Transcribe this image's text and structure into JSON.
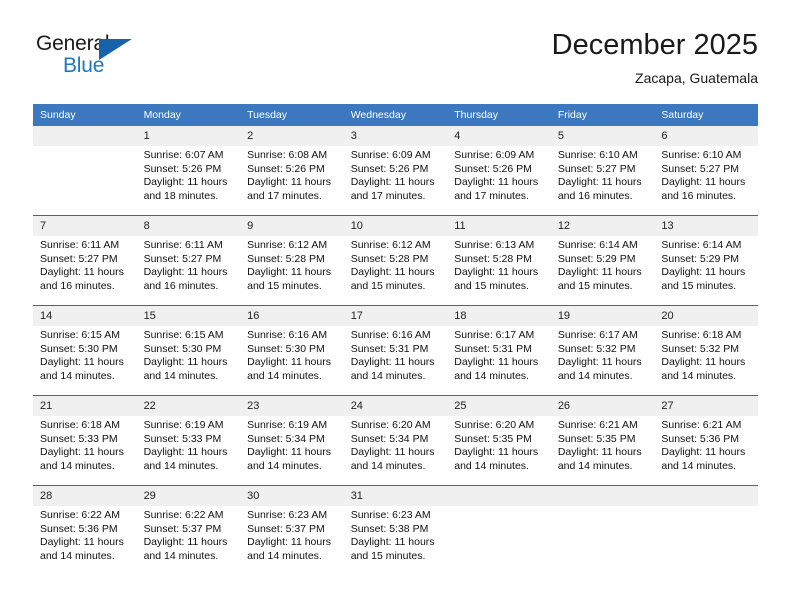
{
  "logo": {
    "word_top": "General",
    "word_bottom": "Blue",
    "accent_color": "#1763ab",
    "blue_text_color": "#1f78c1"
  },
  "header": {
    "title": "December 2025",
    "subtitle": "Zacapa, Guatemala"
  },
  "theme": {
    "header_bg": "#3b78bf",
    "header_text": "#ffffff",
    "daynum_bg": "#f0f0f0",
    "row_divider": "#2e6daa"
  },
  "weekdays": [
    "Sunday",
    "Monday",
    "Tuesday",
    "Wednesday",
    "Thursday",
    "Friday",
    "Saturday"
  ],
  "weeks": [
    [
      {
        "day": "",
        "sunrise": "",
        "sunset": "",
        "daylight": ""
      },
      {
        "day": "1",
        "sunrise": "Sunrise: 6:07 AM",
        "sunset": "Sunset: 5:26 PM",
        "daylight": "Daylight: 11 hours and 18 minutes."
      },
      {
        "day": "2",
        "sunrise": "Sunrise: 6:08 AM",
        "sunset": "Sunset: 5:26 PM",
        "daylight": "Daylight: 11 hours and 17 minutes."
      },
      {
        "day": "3",
        "sunrise": "Sunrise: 6:09 AM",
        "sunset": "Sunset: 5:26 PM",
        "daylight": "Daylight: 11 hours and 17 minutes."
      },
      {
        "day": "4",
        "sunrise": "Sunrise: 6:09 AM",
        "sunset": "Sunset: 5:26 PM",
        "daylight": "Daylight: 11 hours and 17 minutes."
      },
      {
        "day": "5",
        "sunrise": "Sunrise: 6:10 AM",
        "sunset": "Sunset: 5:27 PM",
        "daylight": "Daylight: 11 hours and 16 minutes."
      },
      {
        "day": "6",
        "sunrise": "Sunrise: 6:10 AM",
        "sunset": "Sunset: 5:27 PM",
        "daylight": "Daylight: 11 hours and 16 minutes."
      }
    ],
    [
      {
        "day": "7",
        "sunrise": "Sunrise: 6:11 AM",
        "sunset": "Sunset: 5:27 PM",
        "daylight": "Daylight: 11 hours and 16 minutes."
      },
      {
        "day": "8",
        "sunrise": "Sunrise: 6:11 AM",
        "sunset": "Sunset: 5:27 PM",
        "daylight": "Daylight: 11 hours and 16 minutes."
      },
      {
        "day": "9",
        "sunrise": "Sunrise: 6:12 AM",
        "sunset": "Sunset: 5:28 PM",
        "daylight": "Daylight: 11 hours and 15 minutes."
      },
      {
        "day": "10",
        "sunrise": "Sunrise: 6:12 AM",
        "sunset": "Sunset: 5:28 PM",
        "daylight": "Daylight: 11 hours and 15 minutes."
      },
      {
        "day": "11",
        "sunrise": "Sunrise: 6:13 AM",
        "sunset": "Sunset: 5:28 PM",
        "daylight": "Daylight: 11 hours and 15 minutes."
      },
      {
        "day": "12",
        "sunrise": "Sunrise: 6:14 AM",
        "sunset": "Sunset: 5:29 PM",
        "daylight": "Daylight: 11 hours and 15 minutes."
      },
      {
        "day": "13",
        "sunrise": "Sunrise: 6:14 AM",
        "sunset": "Sunset: 5:29 PM",
        "daylight": "Daylight: 11 hours and 15 minutes."
      }
    ],
    [
      {
        "day": "14",
        "sunrise": "Sunrise: 6:15 AM",
        "sunset": "Sunset: 5:30 PM",
        "daylight": "Daylight: 11 hours and 14 minutes."
      },
      {
        "day": "15",
        "sunrise": "Sunrise: 6:15 AM",
        "sunset": "Sunset: 5:30 PM",
        "daylight": "Daylight: 11 hours and 14 minutes."
      },
      {
        "day": "16",
        "sunrise": "Sunrise: 6:16 AM",
        "sunset": "Sunset: 5:30 PM",
        "daylight": "Daylight: 11 hours and 14 minutes."
      },
      {
        "day": "17",
        "sunrise": "Sunrise: 6:16 AM",
        "sunset": "Sunset: 5:31 PM",
        "daylight": "Daylight: 11 hours and 14 minutes."
      },
      {
        "day": "18",
        "sunrise": "Sunrise: 6:17 AM",
        "sunset": "Sunset: 5:31 PM",
        "daylight": "Daylight: 11 hours and 14 minutes."
      },
      {
        "day": "19",
        "sunrise": "Sunrise: 6:17 AM",
        "sunset": "Sunset: 5:32 PM",
        "daylight": "Daylight: 11 hours and 14 minutes."
      },
      {
        "day": "20",
        "sunrise": "Sunrise: 6:18 AM",
        "sunset": "Sunset: 5:32 PM",
        "daylight": "Daylight: 11 hours and 14 minutes."
      }
    ],
    [
      {
        "day": "21",
        "sunrise": "Sunrise: 6:18 AM",
        "sunset": "Sunset: 5:33 PM",
        "daylight": "Daylight: 11 hours and 14 minutes."
      },
      {
        "day": "22",
        "sunrise": "Sunrise: 6:19 AM",
        "sunset": "Sunset: 5:33 PM",
        "daylight": "Daylight: 11 hours and 14 minutes."
      },
      {
        "day": "23",
        "sunrise": "Sunrise: 6:19 AM",
        "sunset": "Sunset: 5:34 PM",
        "daylight": "Daylight: 11 hours and 14 minutes."
      },
      {
        "day": "24",
        "sunrise": "Sunrise: 6:20 AM",
        "sunset": "Sunset: 5:34 PM",
        "daylight": "Daylight: 11 hours and 14 minutes."
      },
      {
        "day": "25",
        "sunrise": "Sunrise: 6:20 AM",
        "sunset": "Sunset: 5:35 PM",
        "daylight": "Daylight: 11 hours and 14 minutes."
      },
      {
        "day": "26",
        "sunrise": "Sunrise: 6:21 AM",
        "sunset": "Sunset: 5:35 PM",
        "daylight": "Daylight: 11 hours and 14 minutes."
      },
      {
        "day": "27",
        "sunrise": "Sunrise: 6:21 AM",
        "sunset": "Sunset: 5:36 PM",
        "daylight": "Daylight: 11 hours and 14 minutes."
      }
    ],
    [
      {
        "day": "28",
        "sunrise": "Sunrise: 6:22 AM",
        "sunset": "Sunset: 5:36 PM",
        "daylight": "Daylight: 11 hours and 14 minutes."
      },
      {
        "day": "29",
        "sunrise": "Sunrise: 6:22 AM",
        "sunset": "Sunset: 5:37 PM",
        "daylight": "Daylight: 11 hours and 14 minutes."
      },
      {
        "day": "30",
        "sunrise": "Sunrise: 6:23 AM",
        "sunset": "Sunset: 5:37 PM",
        "daylight": "Daylight: 11 hours and 14 minutes."
      },
      {
        "day": "31",
        "sunrise": "Sunrise: 6:23 AM",
        "sunset": "Sunset: 5:38 PM",
        "daylight": "Daylight: 11 hours and 15 minutes."
      },
      {
        "day": "",
        "sunrise": "",
        "sunset": "",
        "daylight": ""
      },
      {
        "day": "",
        "sunrise": "",
        "sunset": "",
        "daylight": ""
      },
      {
        "day": "",
        "sunrise": "",
        "sunset": "",
        "daylight": ""
      }
    ]
  ]
}
